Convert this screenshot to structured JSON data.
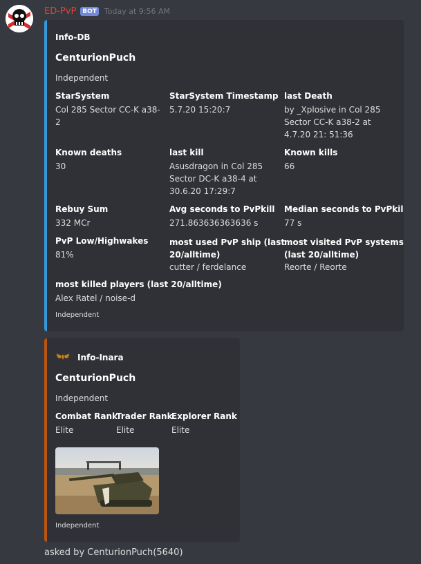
{
  "message": {
    "username": "ED-PvP",
    "bot_badge": "BOT",
    "timestamp": "Today at 9:56 AM",
    "footer_text": "asked by CenturionPuch(5640)"
  },
  "embed_db": {
    "author": "Info-DB",
    "title": "CenturionPuch",
    "description": "Independent",
    "fields": [
      {
        "name": "StarSystem",
        "value": "Col 285 Sector CC-K a38-\n2"
      },
      {
        "name": "StarSystem Timestamp",
        "value": "5.7.20 15:20:7"
      },
      {
        "name": "last Death",
        "value": "by _Xplosive in Col 285\nSector CC-K a38-2 at\n4.7.20 21: 51:36"
      },
      {
        "name": "Known deaths",
        "value": "30"
      },
      {
        "name": "last kill",
        "value": "Asusdragon in Col 285\nSector DC-K a38-4 at\n30.6.20 17:29:7"
      },
      {
        "name": "Known kills",
        "value": "66"
      },
      {
        "name": "Rebuy Sum",
        "value": "332 MCr"
      },
      {
        "name": "Avg seconds to PvPkill",
        "value": "271.863636363636 s"
      },
      {
        "name": "Median seconds to PvPkill",
        "value": "77 s"
      },
      {
        "name": "PvP Low/Highwakes",
        "value": "81%"
      },
      {
        "name": "most used PvP ship (last\n20/alltime)",
        "value": "cutter / ferdelance"
      },
      {
        "name": "most visited PvP systems\n(last 20/alltime)",
        "value": "Reorte / Reorte"
      },
      {
        "name": "most killed players (last 20/alltime)",
        "value": "Alex Ratel / noise-d"
      }
    ],
    "footer": "Independent",
    "accent_color": "#3498db"
  },
  "embed_inara": {
    "author": "Info-Inara",
    "author_icon": "inara-wings-icon",
    "title": "CenturionPuch",
    "description": "Independent",
    "fields": [
      {
        "name": "Combat Rank",
        "value": "Elite"
      },
      {
        "name": "Trader Rank",
        "value": "Elite"
      },
      {
        "name": "Explorer Rank",
        "value": "Elite"
      }
    ],
    "thumbnail": "tank-photo",
    "footer": "Independent",
    "accent_color": "#b8550f"
  }
}
